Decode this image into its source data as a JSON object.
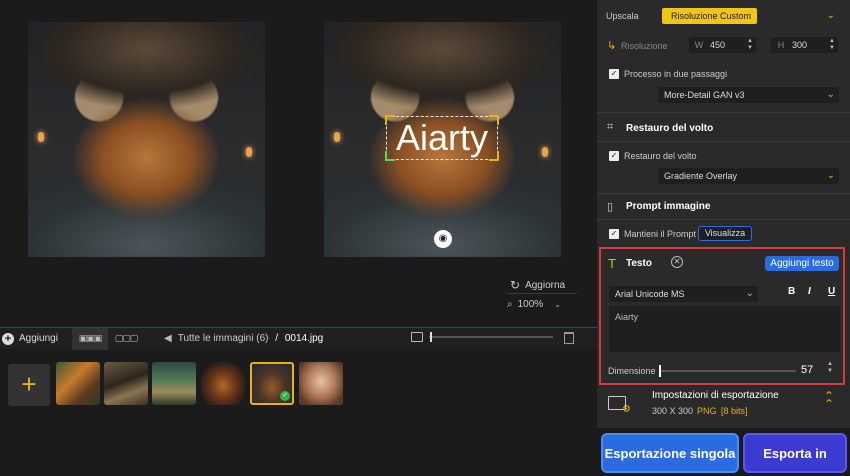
{
  "preview": {
    "overlay_text": "Aiarty",
    "refresh_label": "Aggiorna",
    "zoom_value": "100%"
  },
  "toolbar": {
    "add_label": "Aggiungi",
    "path_label": "Tutte le immagini (6)",
    "path_sep": "/",
    "file_name": "0014.jpg"
  },
  "thumbnails": {
    "add_symbol": "+",
    "count": 6,
    "selected_index": 5
  },
  "panel": {
    "upscale": {
      "label": "Upscala",
      "value": "Risoluzione Custom"
    },
    "resolution": {
      "label": "Risoluzione",
      "w_label": "W",
      "w_value": "450",
      "h_label": "H",
      "h_value": "300"
    },
    "two_pass": {
      "label": "Processo in due passaggi",
      "checked": true
    },
    "model": {
      "value": "More-Detail GAN  v3"
    },
    "face_section": {
      "title": "Restauro del volto"
    },
    "face_restore": {
      "label": "Restauro del volto",
      "checked": true
    },
    "face_mode": {
      "value": "Gradiente Overlay"
    },
    "prompt_section": {
      "title": "Prompt immagine"
    },
    "keep_prompt": {
      "label": "Mantieni il Prompt",
      "checked": true,
      "view_label": "Visualizza"
    },
    "text_section": {
      "title": "Testo",
      "add_text_label": "Aggiungi testo",
      "font": "Arial Unicode MS",
      "bold": "B",
      "italic": "I",
      "underline": "U",
      "text_value": "Aiarty",
      "size_label": "Dimensione",
      "size_value": "57"
    },
    "export": {
      "title": "Impostazioni di esportazione",
      "dims": "300 X 300",
      "format": "PNG",
      "bits": "[8 bits]",
      "single_label": "Esportazione singola",
      "batch_label": "Esporta in batch"
    }
  },
  "colors": {
    "accent": "#e6b21a",
    "blue": "#2a6ce0",
    "highlight_border": "#d83a3a"
  }
}
